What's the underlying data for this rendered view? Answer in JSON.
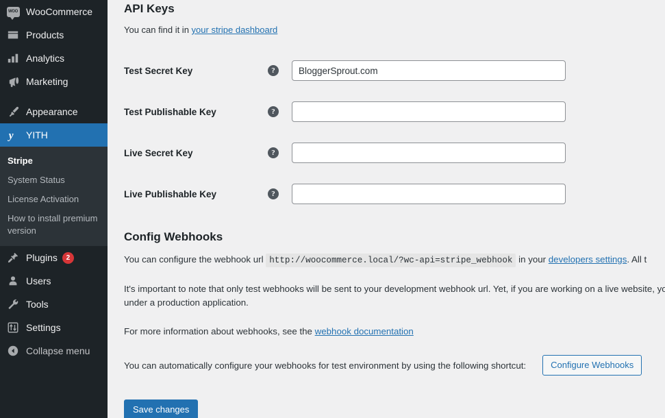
{
  "colors": {
    "sidebar_bg": "#1d2327",
    "submenu_bg": "#2c3338",
    "accent_blue": "#2271b1",
    "content_bg": "#f0f0f1",
    "badge_red": "#d63638"
  },
  "sidebar": {
    "items": [
      {
        "label": "WooCommerce",
        "icon": "woocommerce-icon",
        "active": false
      },
      {
        "label": "Products",
        "icon": "products-box-icon",
        "active": false
      },
      {
        "label": "Analytics",
        "icon": "analytics-bars-icon",
        "active": false
      },
      {
        "label": "Marketing",
        "icon": "marketing-megaphone-icon",
        "active": false
      },
      {
        "label": "Appearance",
        "icon": "appearance-brush-icon",
        "active": false
      },
      {
        "label": "YITH",
        "icon": "yith-logo-icon",
        "active": true
      },
      {
        "label": "Plugins",
        "icon": "plugins-plug-icon",
        "active": false,
        "badge": "2"
      },
      {
        "label": "Users",
        "icon": "users-person-icon",
        "active": false
      },
      {
        "label": "Tools",
        "icon": "tools-wrench-icon",
        "active": false
      },
      {
        "label": "Settings",
        "icon": "settings-sliders-icon",
        "active": false
      },
      {
        "label": "Collapse menu",
        "icon": "collapse-arrow-icon",
        "active": false
      }
    ],
    "submenu": [
      {
        "label": "Stripe",
        "current": true
      },
      {
        "label": "System Status",
        "current": false
      },
      {
        "label": "License Activation",
        "current": false
      },
      {
        "label": "How to install premium version",
        "current": false
      }
    ]
  },
  "api_keys": {
    "title": "API Keys",
    "subtitle_prefix": "You can find it in ",
    "subtitle_link": "your stripe dashboard",
    "fields": [
      {
        "label": "Test Secret Key",
        "value": "BloggerSprout.com",
        "placeholder": ""
      },
      {
        "label": "Test Publishable Key",
        "value": "",
        "placeholder": ""
      },
      {
        "label": "Live Secret Key",
        "value": "",
        "placeholder": ""
      },
      {
        "label": "Live Publishable Key",
        "value": "",
        "placeholder": ""
      }
    ]
  },
  "webhooks": {
    "title": "Config Webhooks",
    "p1_before": "You can configure the webhook url",
    "p1_code": "http://woocommerce.local/?wc-api=stripe_webhook",
    "p1_middle": "in your",
    "p1_link": "developers settings",
    "p1_after": ". All t",
    "p2": "It's important to note that only test webhooks will be sent to your development webhook url. Yet, if you are working on a live website, you should configure your webhook under a production application.",
    "p3_before": "For more information about webhooks, see the ",
    "p3_link": "webhook documentation",
    "shortcut_text": "You can automatically configure your webhooks for test environment by using the following shortcut:",
    "configure_button": "Configure Webhooks"
  },
  "footer": {
    "save_button": "Save changes"
  }
}
